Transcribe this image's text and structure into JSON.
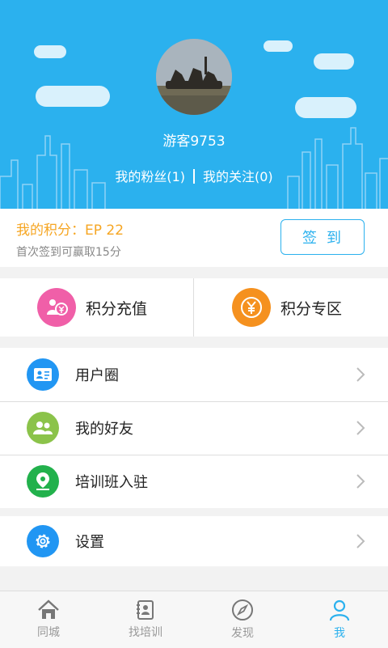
{
  "profile": {
    "username": "游客9753",
    "fans_label": "我的粉丝(1)",
    "follow_label": "我的关注(0)"
  },
  "points": {
    "title": "我的积分：EP 22",
    "subtitle": "首次签到可赢取15分",
    "signin_label": "签到"
  },
  "quick": {
    "recharge_label": "积分充值",
    "zone_label": "积分专区"
  },
  "menu": {
    "items": [
      {
        "label": "用户圈",
        "icon": "id-card-icon",
        "color": "#2196f3"
      },
      {
        "label": "我的好友",
        "icon": "friends-icon",
        "color": "#8bc34a"
      },
      {
        "label": "培训班入驻",
        "icon": "location-pin-icon",
        "color": "#22b14c"
      }
    ],
    "settings_label": "设置"
  },
  "tabs": [
    {
      "label": "同城",
      "icon": "home-icon"
    },
    {
      "label": "找培训",
      "icon": "contact-book-icon"
    },
    {
      "label": "发现",
      "icon": "compass-icon"
    },
    {
      "label": "我",
      "icon": "person-icon",
      "active": true
    }
  ],
  "colors": {
    "accent": "#2bb1ee",
    "points_title": "#f6a623",
    "recharge_icon_bg": "#f05fa8",
    "zone_icon_bg": "#f5911f"
  }
}
